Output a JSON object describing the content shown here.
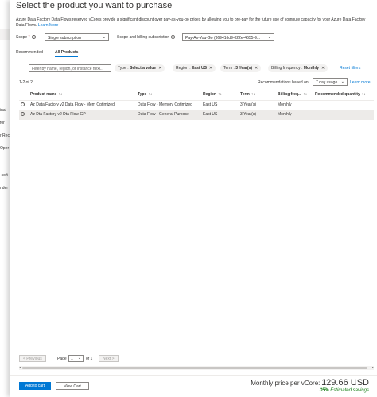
{
  "background": {
    "fragments": [
      "inal",
      "for",
      "r Rec",
      "Oper",
      "-soft",
      "nder"
    ]
  },
  "panel": {
    "title": "Select the product you want to purchase",
    "description": "Azure Data Factory Data Flows reserved vCores provide a significant discount over pay-as-you-go prices by allowing you to pre-pay for the future use of compute capacity for your Azure Data Factory Data Flows.",
    "learn_more": "Learn More"
  },
  "scope": {
    "label": "Scope",
    "required": "*",
    "value": "Single subscription",
    "billing_label": "Scope and billing subscription",
    "billing_value": "Pay-As-You-Go (369416d9-022e-4655-9..."
  },
  "tabs": [
    {
      "label": "Recommended"
    },
    {
      "label": "All Products"
    }
  ],
  "filters": {
    "search_placeholder": "Filter by name, region, or instance flexi...",
    "pills": [
      {
        "key": "Type :",
        "value": "Select a value"
      },
      {
        "key": "Region :",
        "value": "East US"
      },
      {
        "key": "Term :",
        "value": "3 Year(s)"
      },
      {
        "key": "Billing frequency :",
        "value": "Monthly"
      }
    ],
    "reset": "Reset filters"
  },
  "results": {
    "count": "1-2 of 2",
    "recommendations_label": "Recommendations based on",
    "recommendations_value": "7 day usage",
    "learn_more": "Learn more"
  },
  "table": {
    "columns": [
      "Product name",
      "Type",
      "Region",
      "Term",
      "Billing freq...",
      "Recommended quantity"
    ],
    "rows": [
      [
        "Az Data Factory v2 Data Flow - Mem Optimized",
        "Data Flow - Memory Optimized",
        "East US",
        "3 Year(s)",
        "Monthly",
        ""
      ],
      [
        "Az Dta Factory v2 Dta Flow-GP",
        "Data Flow - General Purpose",
        "East US",
        "3 Year(s)",
        "Monthly",
        ""
      ]
    ]
  },
  "pager": {
    "previous": "< Previous",
    "page_label": "Page",
    "page_value": "1",
    "of": "of 1",
    "next": "Next >"
  },
  "footer": {
    "add_to_cart": "Add to cart",
    "view_cart": "View Cart",
    "price_label": "Monthly price per vCore:",
    "price_value": "129.66 USD",
    "savings_pct": "35%",
    "savings_text": "Estimated savings"
  },
  "colors": {
    "accent": "#0078d4",
    "savings": "#107c10",
    "selected_row": "#edebe9"
  }
}
